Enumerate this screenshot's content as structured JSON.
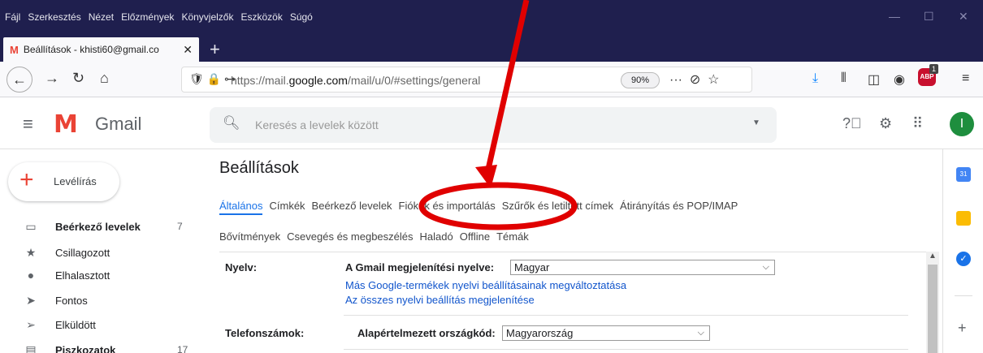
{
  "browser": {
    "menu": [
      "Fájl",
      "Szerkesztés",
      "Nézet",
      "Előzmények",
      "Könyvjelzők",
      "Eszközök",
      "Súgó"
    ],
    "tab_title": "Beállítások - khisti60@gmail.co",
    "url_prefix": "https://mail.",
    "url_domain": "google.com",
    "url_path": "/mail/u/0/#settings/general",
    "zoom": "90%",
    "abp_badge": "1",
    "abp_label": "ABP"
  },
  "gmail": {
    "app_name": "Gmail",
    "search_placeholder": "Keresés a levelek között",
    "avatar_letter": "I"
  },
  "sidebar": {
    "compose_label": "Levélírás",
    "items": [
      {
        "label": "Beérkező levelek",
        "count": "7",
        "icon": "inbox-icon"
      },
      {
        "label": "Csillagozott",
        "count": "",
        "icon": "star-icon"
      },
      {
        "label": "Elhalasztott",
        "count": "",
        "icon": "snooze-clock-icon"
      },
      {
        "label": "Fontos",
        "count": "",
        "icon": "important-label-icon"
      },
      {
        "label": "Elküldött",
        "count": "",
        "icon": "send-icon"
      },
      {
        "label": "Piszkozatok",
        "count": "17",
        "icon": "draft-icon"
      }
    ]
  },
  "settings": {
    "title": "Beállítások",
    "tabs_row1": [
      "Általános",
      "Címkék",
      "Beérkező levelek",
      "Fiókok és importálás",
      "Szűrők és letiltott címek",
      "Átirányítás és POP/IMAP"
    ],
    "tabs_row2": [
      "Bővítmények",
      "Csevegés és megbeszélés",
      "Haladó",
      "Offline",
      "Témák"
    ],
    "language": {
      "label": "Nyelv:",
      "field_label": "A Gmail megjelenítési nyelve:",
      "value": "Magyar",
      "link1": "Más Google-termékek nyelvi beállításainak megváltoztatása",
      "link2": "Az összes nyelvi beállítás megjelenítése"
    },
    "phone": {
      "label": "Telefonszámok:",
      "field_label": "Alapértelmezett országkód:",
      "value": "Magyarország"
    }
  },
  "colors": {
    "browser_dark": "#1f1f4e",
    "gmail_red": "#ea4335",
    "link_blue": "#1155cc",
    "active_tab_blue": "#1a73e8",
    "annotation_red": "#e00000"
  }
}
